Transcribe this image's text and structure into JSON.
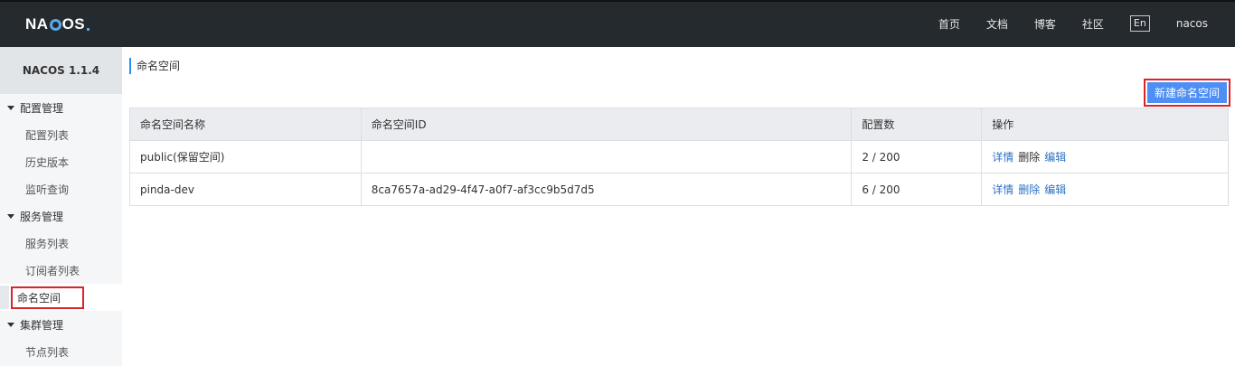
{
  "header": {
    "logo_text_a": "NA",
    "logo_text_b": "OS",
    "nav": [
      "首页",
      "文档",
      "博客",
      "社区"
    ],
    "lang": "En",
    "user": "nacos"
  },
  "sidebar": {
    "version": "NACOS 1.1.4",
    "groups": [
      {
        "label": "配置管理",
        "items": [
          "配置列表",
          "历史版本",
          "监听查询"
        ]
      },
      {
        "label": "服务管理",
        "items": [
          "服务列表",
          "订阅者列表",
          "命名空间"
        ]
      },
      {
        "label": "集群管理",
        "items": [
          "节点列表"
        ]
      }
    ],
    "active_item": "命名空间"
  },
  "main": {
    "breadcrumb": "命名空间",
    "new_button": "新建命名空间",
    "table": {
      "headers": [
        "命名空间名称",
        "命名空间ID",
        "配置数",
        "操作"
      ],
      "rows": [
        {
          "name": "public(保留空间)",
          "id": "",
          "count": "2 / 200",
          "ops": [
            "详情",
            "删除",
            "编辑"
          ]
        },
        {
          "name": "pinda-dev",
          "id": "8ca7657a-ad29-4f47-a0f7-af3cc9b5d7d5",
          "count": "6 / 200",
          "ops": [
            "详情",
            "删除",
            "编辑"
          ]
        }
      ]
    }
  },
  "colors": {
    "header_bg": "#252a2f",
    "accent": "#4d8ff5",
    "link": "#2f72c4",
    "highlight_border": "#d9242c"
  }
}
